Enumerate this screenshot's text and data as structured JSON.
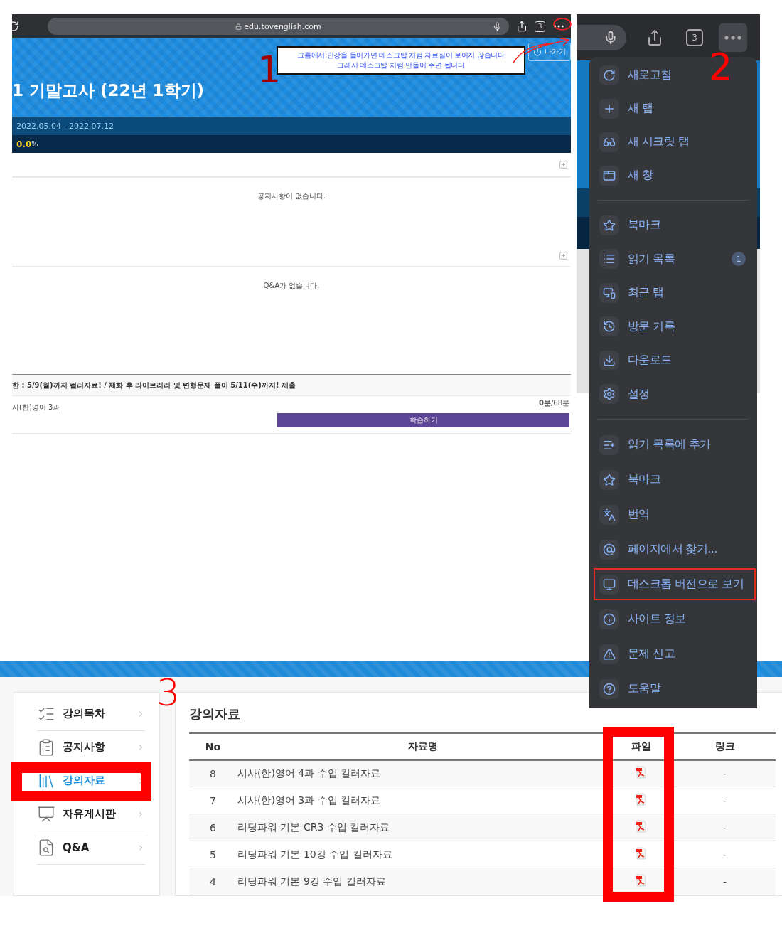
{
  "panel_1": {
    "annotation": "1",
    "browser": {
      "url": "edu.tovenglish.com",
      "tab_count": "3"
    },
    "callout": [
      "크롬에서 인강을 들어가면 데스크탑 처럼 자료실이 보이지 않습니다",
      "그래서 데스크탑 처럼 만들어 주면 됩니다"
    ],
    "exit_button": "나가기",
    "course_title": "1 기말고사 (22년 1학기)",
    "period": "2022.05.04 - 2022.07.12",
    "progress": {
      "value": "0.0",
      "unit": "%"
    },
    "notice_empty": "공지사항이 없습니다.",
    "qna_empty": "Q&A가 없습니다.",
    "lesson": {
      "notice": "한 : 5/9(월)까지 컬러자료! / 체화 후 라이브러리 및 변형문제 풀이 5/11(수)까지! 제출",
      "name": "사(한)영어 3과",
      "time": "0분",
      "total": "/68분",
      "button": "학습하기"
    }
  },
  "panel_2": {
    "annotation": "2",
    "tab_count": "3",
    "menu": [
      [
        {
          "label": "새로고침",
          "annotated": false
        },
        {
          "label": "새 탭",
          "annotated": false
        },
        {
          "label": "새 시크릿 탭",
          "annotated": false
        },
        {
          "label": "새 창",
          "annotated": false
        }
      ],
      [
        {
          "label": "북마크",
          "annotated": false
        },
        {
          "label": "읽기 목록",
          "badge": "1",
          "annotated": false
        },
        {
          "label": "최근 탭",
          "annotated": false
        },
        {
          "label": "방문 기록",
          "annotated": false
        },
        {
          "label": "다운로드",
          "annotated": false
        },
        {
          "label": "설정",
          "annotated": false
        }
      ],
      [
        {
          "label": "읽기 목록에 추가",
          "annotated": false
        },
        {
          "label": "북마크",
          "annotated": false
        },
        {
          "label": "번역",
          "annotated": false
        },
        {
          "label": "페이지에서 찾기...",
          "annotated": false
        },
        {
          "label": "데스크톱 버전으로 보기",
          "annotated": true
        },
        {
          "label": "사이트 정보",
          "annotated": false
        },
        {
          "label": "문제 신고",
          "annotated": false
        },
        {
          "label": "도움말",
          "annotated": false
        }
      ]
    ]
  },
  "panel_3": {
    "annotation": "3",
    "sidebar": [
      {
        "label": "강의목차",
        "selected": false,
        "annotated": false
      },
      {
        "label": "공지사항",
        "selected": false,
        "annotated": false
      },
      {
        "label": "강의자료",
        "selected": true,
        "annotated": true
      },
      {
        "label": "자유게시판",
        "selected": false,
        "annotated": false
      },
      {
        "label": "Q&A",
        "selected": false,
        "annotated": false
      }
    ],
    "title": "강의자료",
    "columns": [
      {
        "label": "No",
        "annotated": false
      },
      {
        "label": "자료명",
        "annotated": false
      },
      {
        "label": "파일",
        "annotated": true
      },
      {
        "label": "링크",
        "annotated": false
      }
    ],
    "rows": [
      {
        "no": "8",
        "title": "시사(한)영어 4과 수업 컬러자료",
        "link": "-"
      },
      {
        "no": "7",
        "title": "시사(한)영어 3과 수업 컬러자료",
        "link": "-"
      },
      {
        "no": "6",
        "title": "리딩파워 기본 CR3 수업 컬러자료",
        "link": "-"
      },
      {
        "no": "5",
        "title": "리딩파워 기본 10강 수업 컬러자료",
        "link": "-"
      },
      {
        "no": "4",
        "title": "리딩파워 기본 9강 수업 컬러자료",
        "link": "-"
      }
    ]
  }
}
